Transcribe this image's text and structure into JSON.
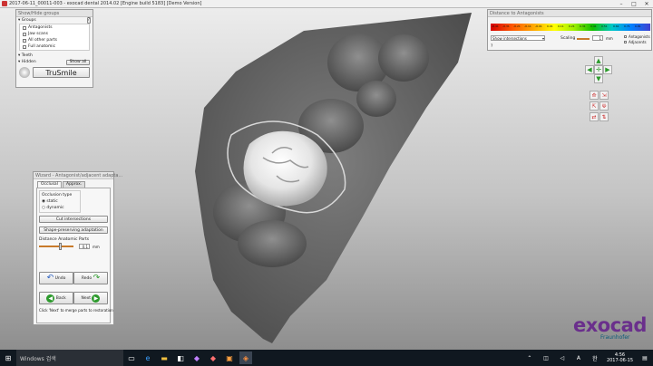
{
  "window": {
    "title": "2017-06-11_00011-003 - exocad dental 2014.02 [Engine build 5183] [Demo Version]",
    "min": "–",
    "max": "□",
    "close": "✕"
  },
  "show_hide": {
    "header": "Show/Hide groups",
    "groups_label": "Groups",
    "help": "?",
    "items": [
      "Antagonists",
      "Jaw scans",
      "All other parts",
      "Full anatomic"
    ],
    "teeth_label": "Teeth",
    "hidden_label": "Hidden",
    "show_all": "Show all",
    "trusmile": "TruSmile"
  },
  "distance": {
    "header": "Distance to Antagonists",
    "ticks": [
      "-0.41",
      "-0.31",
      "-0.21",
      "-0.11",
      "-0.01",
      "0.01",
      "0.11",
      "0.21",
      "0.31",
      "0.41",
      "0.51",
      "0.61",
      "0.71",
      "0.81"
    ],
    "select_value": "Show intersections",
    "scaling_label": "Scaling",
    "scaling_value": "1",
    "scaling_unit": "mm",
    "check_antagonists": "Antagonists",
    "check_adjacents": "Adjacents",
    "help": "?"
  },
  "wizard": {
    "header": "Wizard - Antagonist/adjacent adapta...",
    "tab_occlusal": "Occlusal",
    "tab_approx": "Approx.",
    "occlusion_type_label": "Occlusion type",
    "radio_static": "static",
    "radio_dynamic": "dynamic",
    "cut_intersections": "Cut intersections",
    "shape_preserving": "Shape-preserving adaptation",
    "distance_label": "Distance Anatomic Parts",
    "distance_value": "0.1",
    "distance_unit": "mm",
    "undo": "Undo",
    "redo": "Redo",
    "back": "Back",
    "next": "Next",
    "hint": "Click 'Next' to merge parts to restoration"
  },
  "brand": {
    "name": "exocad",
    "sub": "Fraunhofer"
  },
  "taskbar": {
    "search_placeholder": "Windows 검색",
    "time": "4:56",
    "date": "2017-06-15",
    "lang": "A",
    "ime": "한"
  },
  "colors": {
    "accent": "#6a2f8c",
    "taskbar": "#101820",
    "tooth": "#ededed"
  }
}
